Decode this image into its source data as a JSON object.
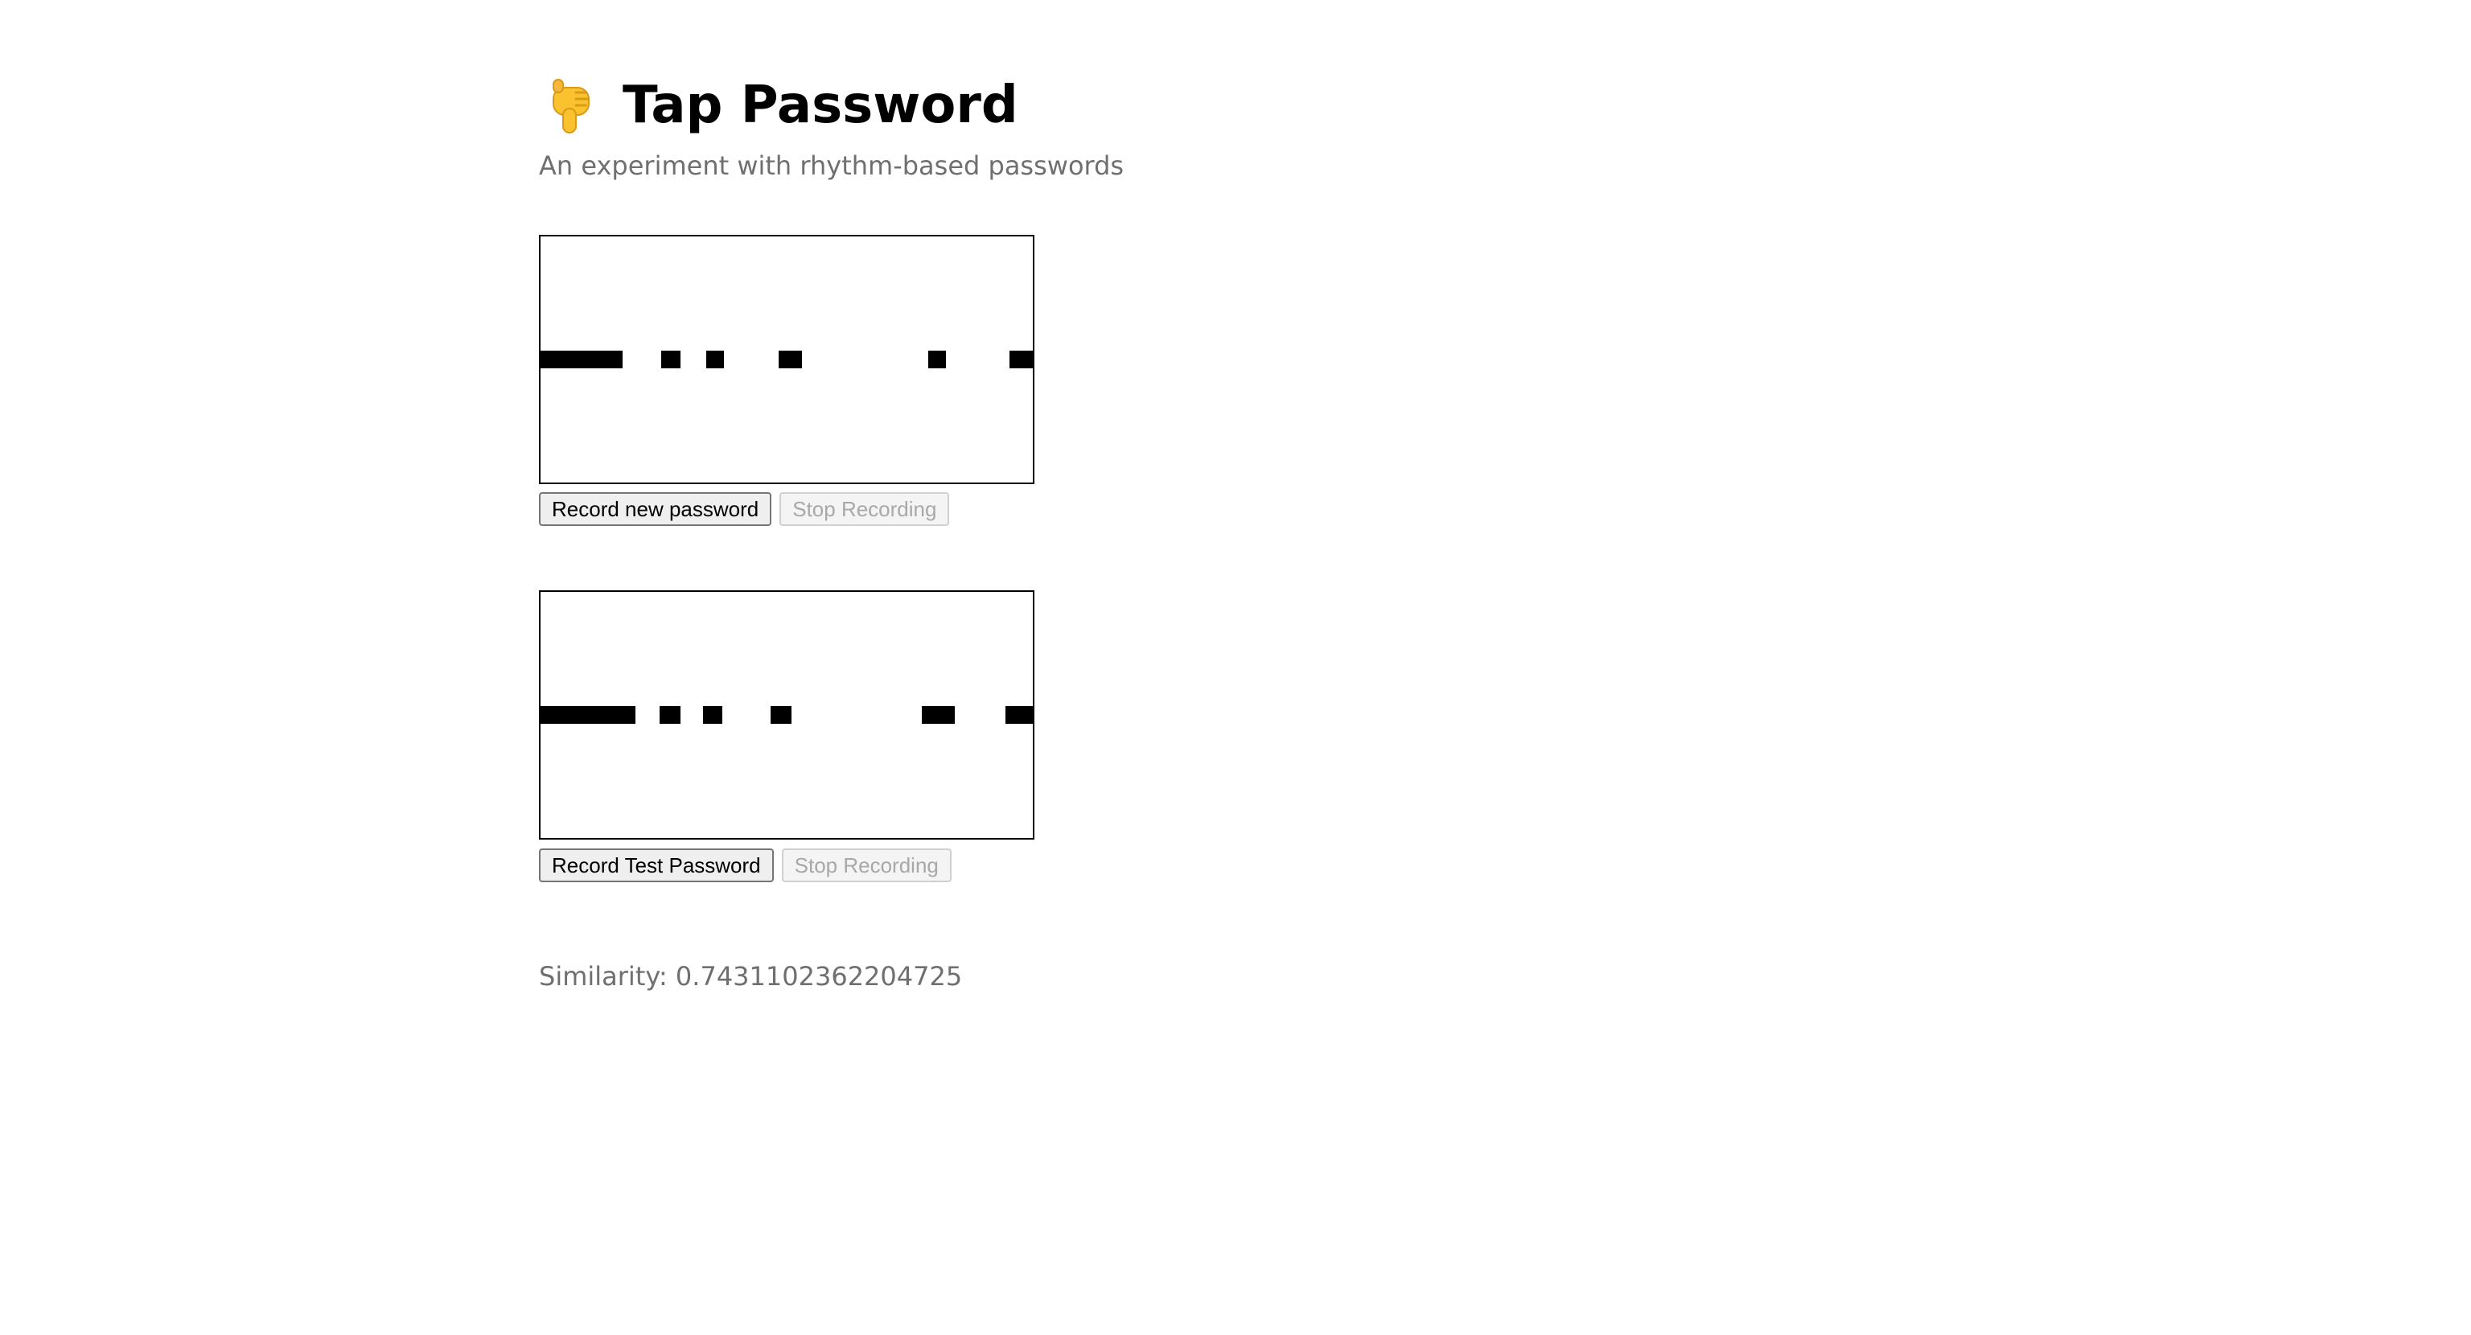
{
  "header": {
    "icon": "pointing-down-hand-icon",
    "title": "Tap Password",
    "subtitle": "An experiment with rhythm-based passwords"
  },
  "recorders": [
    {
      "taps": [
        {
          "start": 0.0,
          "end": 0.166
        },
        {
          "start": 0.245,
          "end": 0.285
        },
        {
          "start": 0.337,
          "end": 0.372
        },
        {
          "start": 0.483,
          "end": 0.531
        },
        {
          "start": 0.788,
          "end": 0.824
        },
        {
          "start": 0.952,
          "end": 1.0
        }
      ],
      "record_label": "Record new password",
      "stop_label": "Stop Recording"
    },
    {
      "taps": [
        {
          "start": 0.0,
          "end": 0.193
        },
        {
          "start": 0.242,
          "end": 0.285
        },
        {
          "start": 0.33,
          "end": 0.369
        },
        {
          "start": 0.467,
          "end": 0.509
        },
        {
          "start": 0.775,
          "end": 0.841
        },
        {
          "start": 0.945,
          "end": 1.0
        }
      ],
      "record_label": "Record Test Password",
      "stop_label": "Stop Recording"
    }
  ],
  "result": {
    "similarity_text": "Similarity: 0.7431102362204725"
  },
  "colors": {
    "tap": "#000000",
    "muted_text": "#6f6f6f",
    "hand": "#f9c22e"
  }
}
